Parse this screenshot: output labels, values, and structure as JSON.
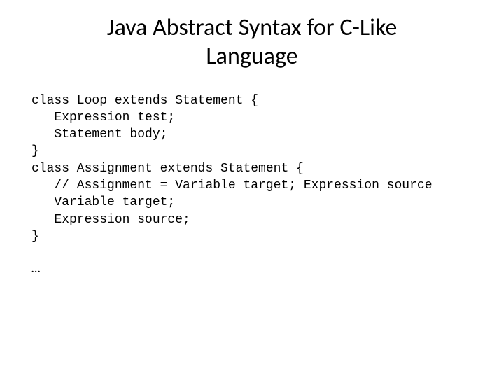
{
  "slide": {
    "title": "Java Abstract Syntax for C-Like Language",
    "code": "class Loop extends Statement {\n   Expression test;\n   Statement body;\n}\nclass Assignment extends Statement {\n   // Assignment = Variable target; Expression source\n   Variable target;\n   Expression source;\n}",
    "ellipsis": "…"
  }
}
